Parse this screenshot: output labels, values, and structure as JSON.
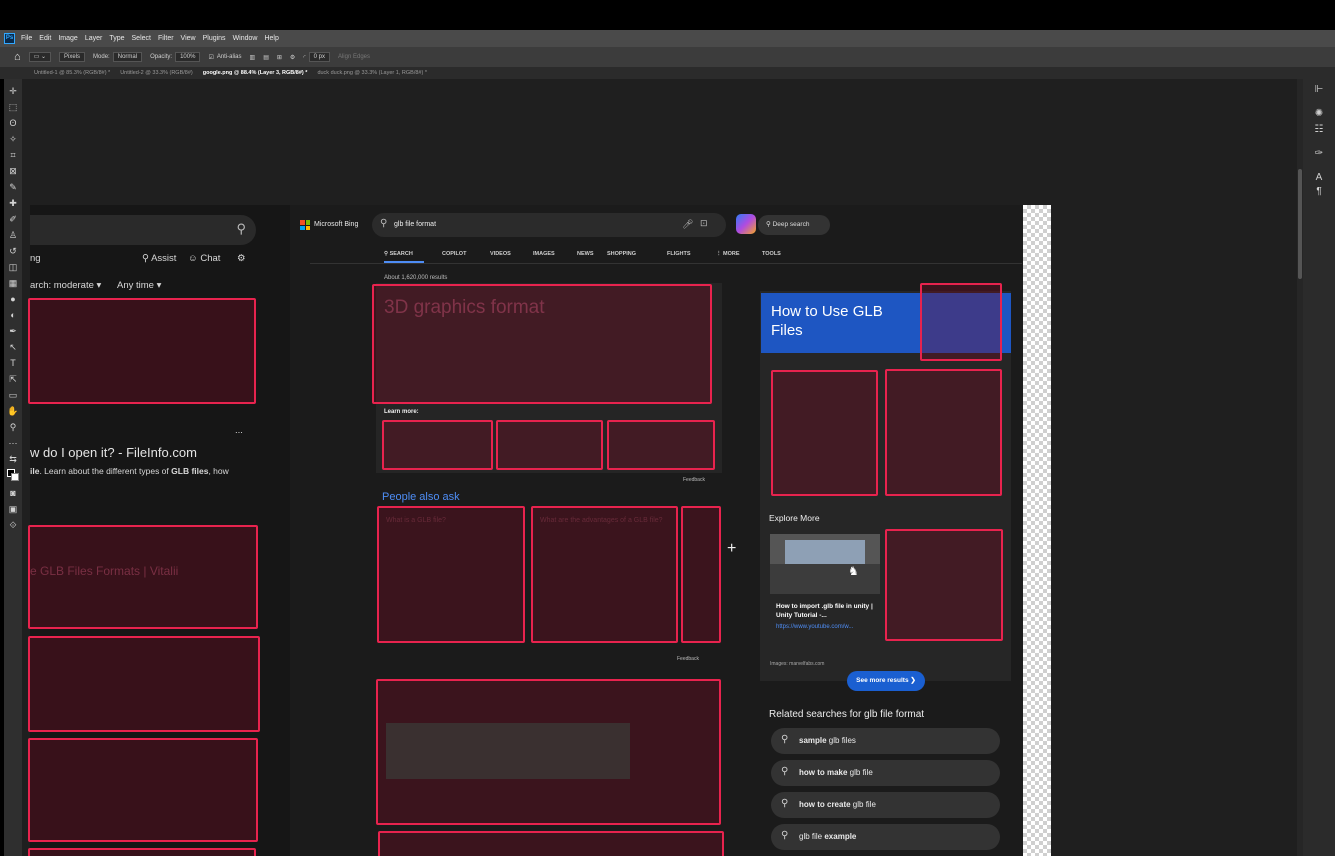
{
  "menubar": {
    "items": [
      "File",
      "Edit",
      "Image",
      "Layer",
      "Type",
      "Select",
      "Filter",
      "View",
      "Plugins",
      "Window",
      "Help"
    ]
  },
  "options": {
    "style_value": "Pixels",
    "mode_label": "Mode:",
    "mode_value": "Normal",
    "opacity_label": "Opacity:",
    "opacity_value": "100%",
    "antialias_label": "Anti-alias",
    "stroke_value": "0 px",
    "align_edges_label": "Align Edges"
  },
  "tabs": [
    {
      "label": "Untitled-1 @ 85.3% (RGB/8#) *",
      "active": false
    },
    {
      "label": "Untitled-2 @ 33.3% (RGB/8#)",
      "active": false
    },
    {
      "label": "google.png @ 88.4% (Layer 3, RGB/8#) *",
      "active": true
    },
    {
      "label": "duck duck.png @ 33.3% (Layer 1, RGB/8#) *",
      "active": false
    }
  ],
  "left_doc": {
    "partial_nav": "ng",
    "assist_label": "Assist",
    "chat_label": "Chat",
    "safesearch_label": "arch: moderate",
    "time_label": "Any time",
    "more_dots": "...",
    "result_title": "w do I open it? - FileInfo.com",
    "result_snippet_bold": "ile",
    "result_snippet": ". Learn about the different types of ",
    "result_snippet_bold2": "GLB files",
    "result_snippet_end": ", how",
    "faint_title": "e GLB Files Formats | Vitalii"
  },
  "bing": {
    "brand": "Microsoft Bing",
    "query": "glb file format",
    "deep_search": "Deep search",
    "nav": [
      "SEARCH",
      "COPILOT",
      "VIDEOS",
      "IMAGES",
      "NEWS",
      "SHOPPING",
      "FLIGHTS",
      "MORE",
      "TOOLS"
    ],
    "results_count": "About 1,620,000 results",
    "main_title": "3D graphics format",
    "learn_more": "Learn more:",
    "feedback": "Feedback",
    "people_also_ask": "People also ask",
    "paa_q1": "What is a GLB file?",
    "paa_q2": "What are the advantages of a GLB file?",
    "knowledge_title": "How to Use GLB Files",
    "explore_more": "Explore More",
    "video_title": "How to import .glb file in unity | Unity Tutorial -...",
    "video_url": "https://www.youtube.com/w...",
    "images_credit": "Images: marvelfabs.com",
    "see_more": "See more results",
    "related_heading": "Related searches for glb file format",
    "related": [
      {
        "bold": "sample",
        "rest": " glb files",
        "bold_first": true
      },
      {
        "bold": "how to make",
        "rest": " glb file",
        "bold_first": true
      },
      {
        "bold": "how to create",
        "rest": " glb file",
        "bold_first": true
      },
      {
        "bold": "example",
        "rest": "glb file ",
        "bold_first": false
      }
    ]
  },
  "colors": {
    "annotation_border": "#e8234e",
    "bing_blue_header": "#1e56c2",
    "link_blue": "#4e8df5"
  }
}
